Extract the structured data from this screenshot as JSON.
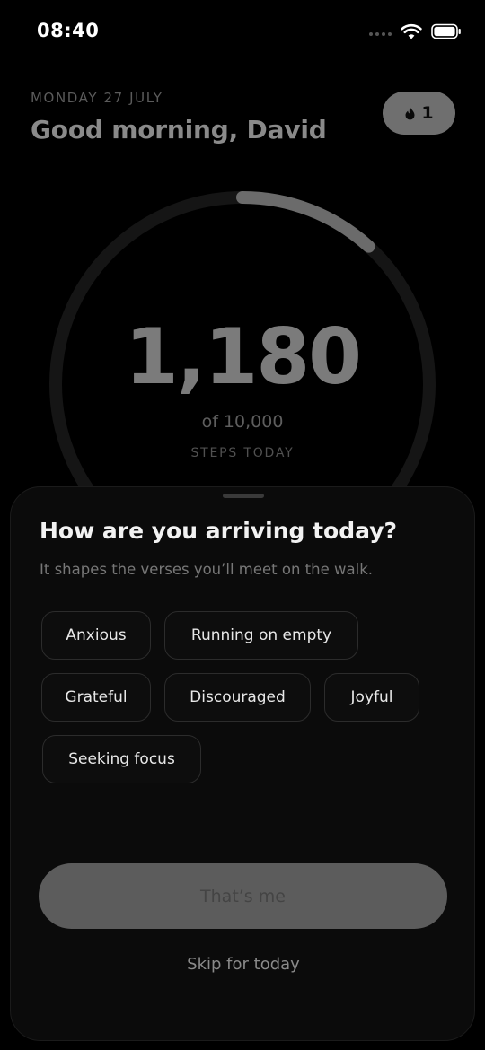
{
  "status_bar": {
    "time": "08:40",
    "icons": [
      "cellular-dots-icon",
      "wifi-icon",
      "battery-icon"
    ]
  },
  "header": {
    "date": "MONDAY 27 JULY",
    "greeting": "Good morning, David",
    "streak": {
      "icon": "flame-icon",
      "count": "1"
    }
  },
  "progress": {
    "steps": "1,180",
    "goal_text": "of 10,000",
    "caption": "STEPS TODAY",
    "steps_value": 1180,
    "goal_value": 10000,
    "fraction": 0.118,
    "ring_track_color": "#151515",
    "ring_progress_color": "#6b6b6b"
  },
  "sheet": {
    "title": "How are you arriving today?",
    "subtitle": "It shapes the verses you’ll meet on the walk.",
    "moods": [
      {
        "label": "Anxious"
      },
      {
        "label": "Running on empty"
      },
      {
        "label": "Grateful"
      },
      {
        "label": "Discouraged"
      },
      {
        "label": "Joyful"
      },
      {
        "label": "Seeking focus"
      }
    ],
    "primary_button": "That’s me",
    "skip_link": "Skip for today"
  }
}
